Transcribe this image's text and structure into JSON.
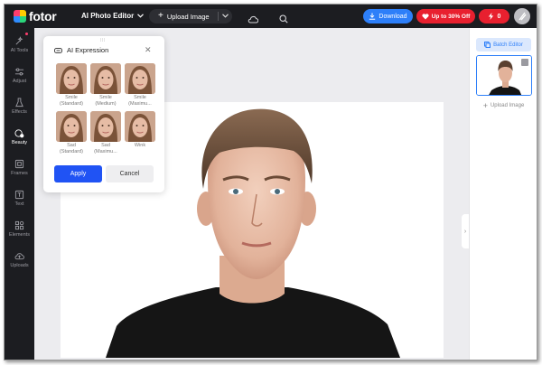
{
  "header": {
    "logo_text": "fotor",
    "app_name": "AI Photo Editor",
    "upload_label": "Upload Image",
    "download_label": "Download",
    "promo_label": "Up to 30% Off",
    "credits_count": "0"
  },
  "sidebar": {
    "items": [
      {
        "label": "AI Tools",
        "icon": "sparkle-icon"
      },
      {
        "label": "Adjust",
        "icon": "sliders-icon"
      },
      {
        "label": "Effects",
        "icon": "flask-icon"
      },
      {
        "label": "Beauty",
        "icon": "beauty-icon"
      },
      {
        "label": "Frames",
        "icon": "frame-icon"
      },
      {
        "label": "Text",
        "icon": "text-icon"
      },
      {
        "label": "Elements",
        "icon": "shapes-icon"
      },
      {
        "label": "Uploads",
        "icon": "cloud-upload-icon"
      }
    ],
    "active": "Beauty"
  },
  "right_panel": {
    "batch_label": "Batch Editor",
    "upload_label": "Upload Image"
  },
  "popup": {
    "title": "AI Expression",
    "tiles": [
      {
        "line1": "Smile",
        "line2": "(Standard)"
      },
      {
        "line1": "Smile",
        "line2": "(Medium)"
      },
      {
        "line1": "Smile",
        "line2": "(Maximu..."
      },
      {
        "line1": "Sad",
        "line2": "(Standard)"
      },
      {
        "line1": "Sad",
        "line2": "(Maximu..."
      },
      {
        "line1": "Wink",
        "line2": ""
      }
    ],
    "apply_label": "Apply",
    "cancel_label": "Cancel"
  },
  "colors": {
    "topbar": "#1c1d21",
    "accent_blue": "#2d7ff9",
    "apply_blue": "#2053f4",
    "promo_red": "#e8202f"
  }
}
